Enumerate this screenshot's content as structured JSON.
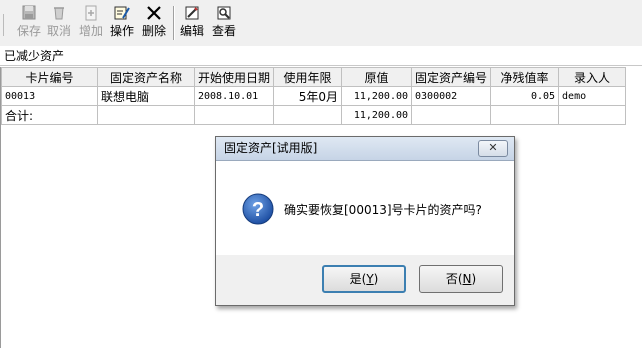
{
  "toolbar": {
    "buttons": [
      {
        "label": "保存",
        "icon": "save-icon",
        "enabled": false
      },
      {
        "label": "取消",
        "icon": "cancel-icon",
        "enabled": false
      },
      {
        "label": "增加",
        "icon": "add-icon",
        "enabled": false
      },
      {
        "label": "操作",
        "icon": "operate-icon",
        "enabled": true
      },
      {
        "label": "删除",
        "icon": "delete-icon",
        "enabled": true
      },
      {
        "label": "编辑",
        "icon": "edit-icon",
        "enabled": true
      },
      {
        "label": "查看",
        "icon": "view-icon",
        "enabled": true
      }
    ]
  },
  "section_title": "已减少资产",
  "grid": {
    "columns": [
      "卡片编号",
      "固定资产名称",
      "开始使用日期",
      "使用年限",
      "原值",
      "固定资产编号",
      "净残值率",
      "录入人"
    ],
    "rows": [
      [
        "00013",
        "联想电脑",
        "2008.10.01",
        "5年0月",
        "11,200.00",
        "0300002",
        "0.05",
        "demo"
      ],
      [
        "合计:",
        "",
        "",
        "",
        "11,200.00",
        "",
        "",
        ""
      ]
    ]
  },
  "dialog": {
    "title": "固定资产[试用版]",
    "message": "确实要恢复[00013]号卡片的资产吗?",
    "yes_text": "是(",
    "yes_key": "Y",
    "no_text": "否(",
    "no_key": "N",
    "close_glyph": "✕",
    "icon": "question-icon"
  }
}
